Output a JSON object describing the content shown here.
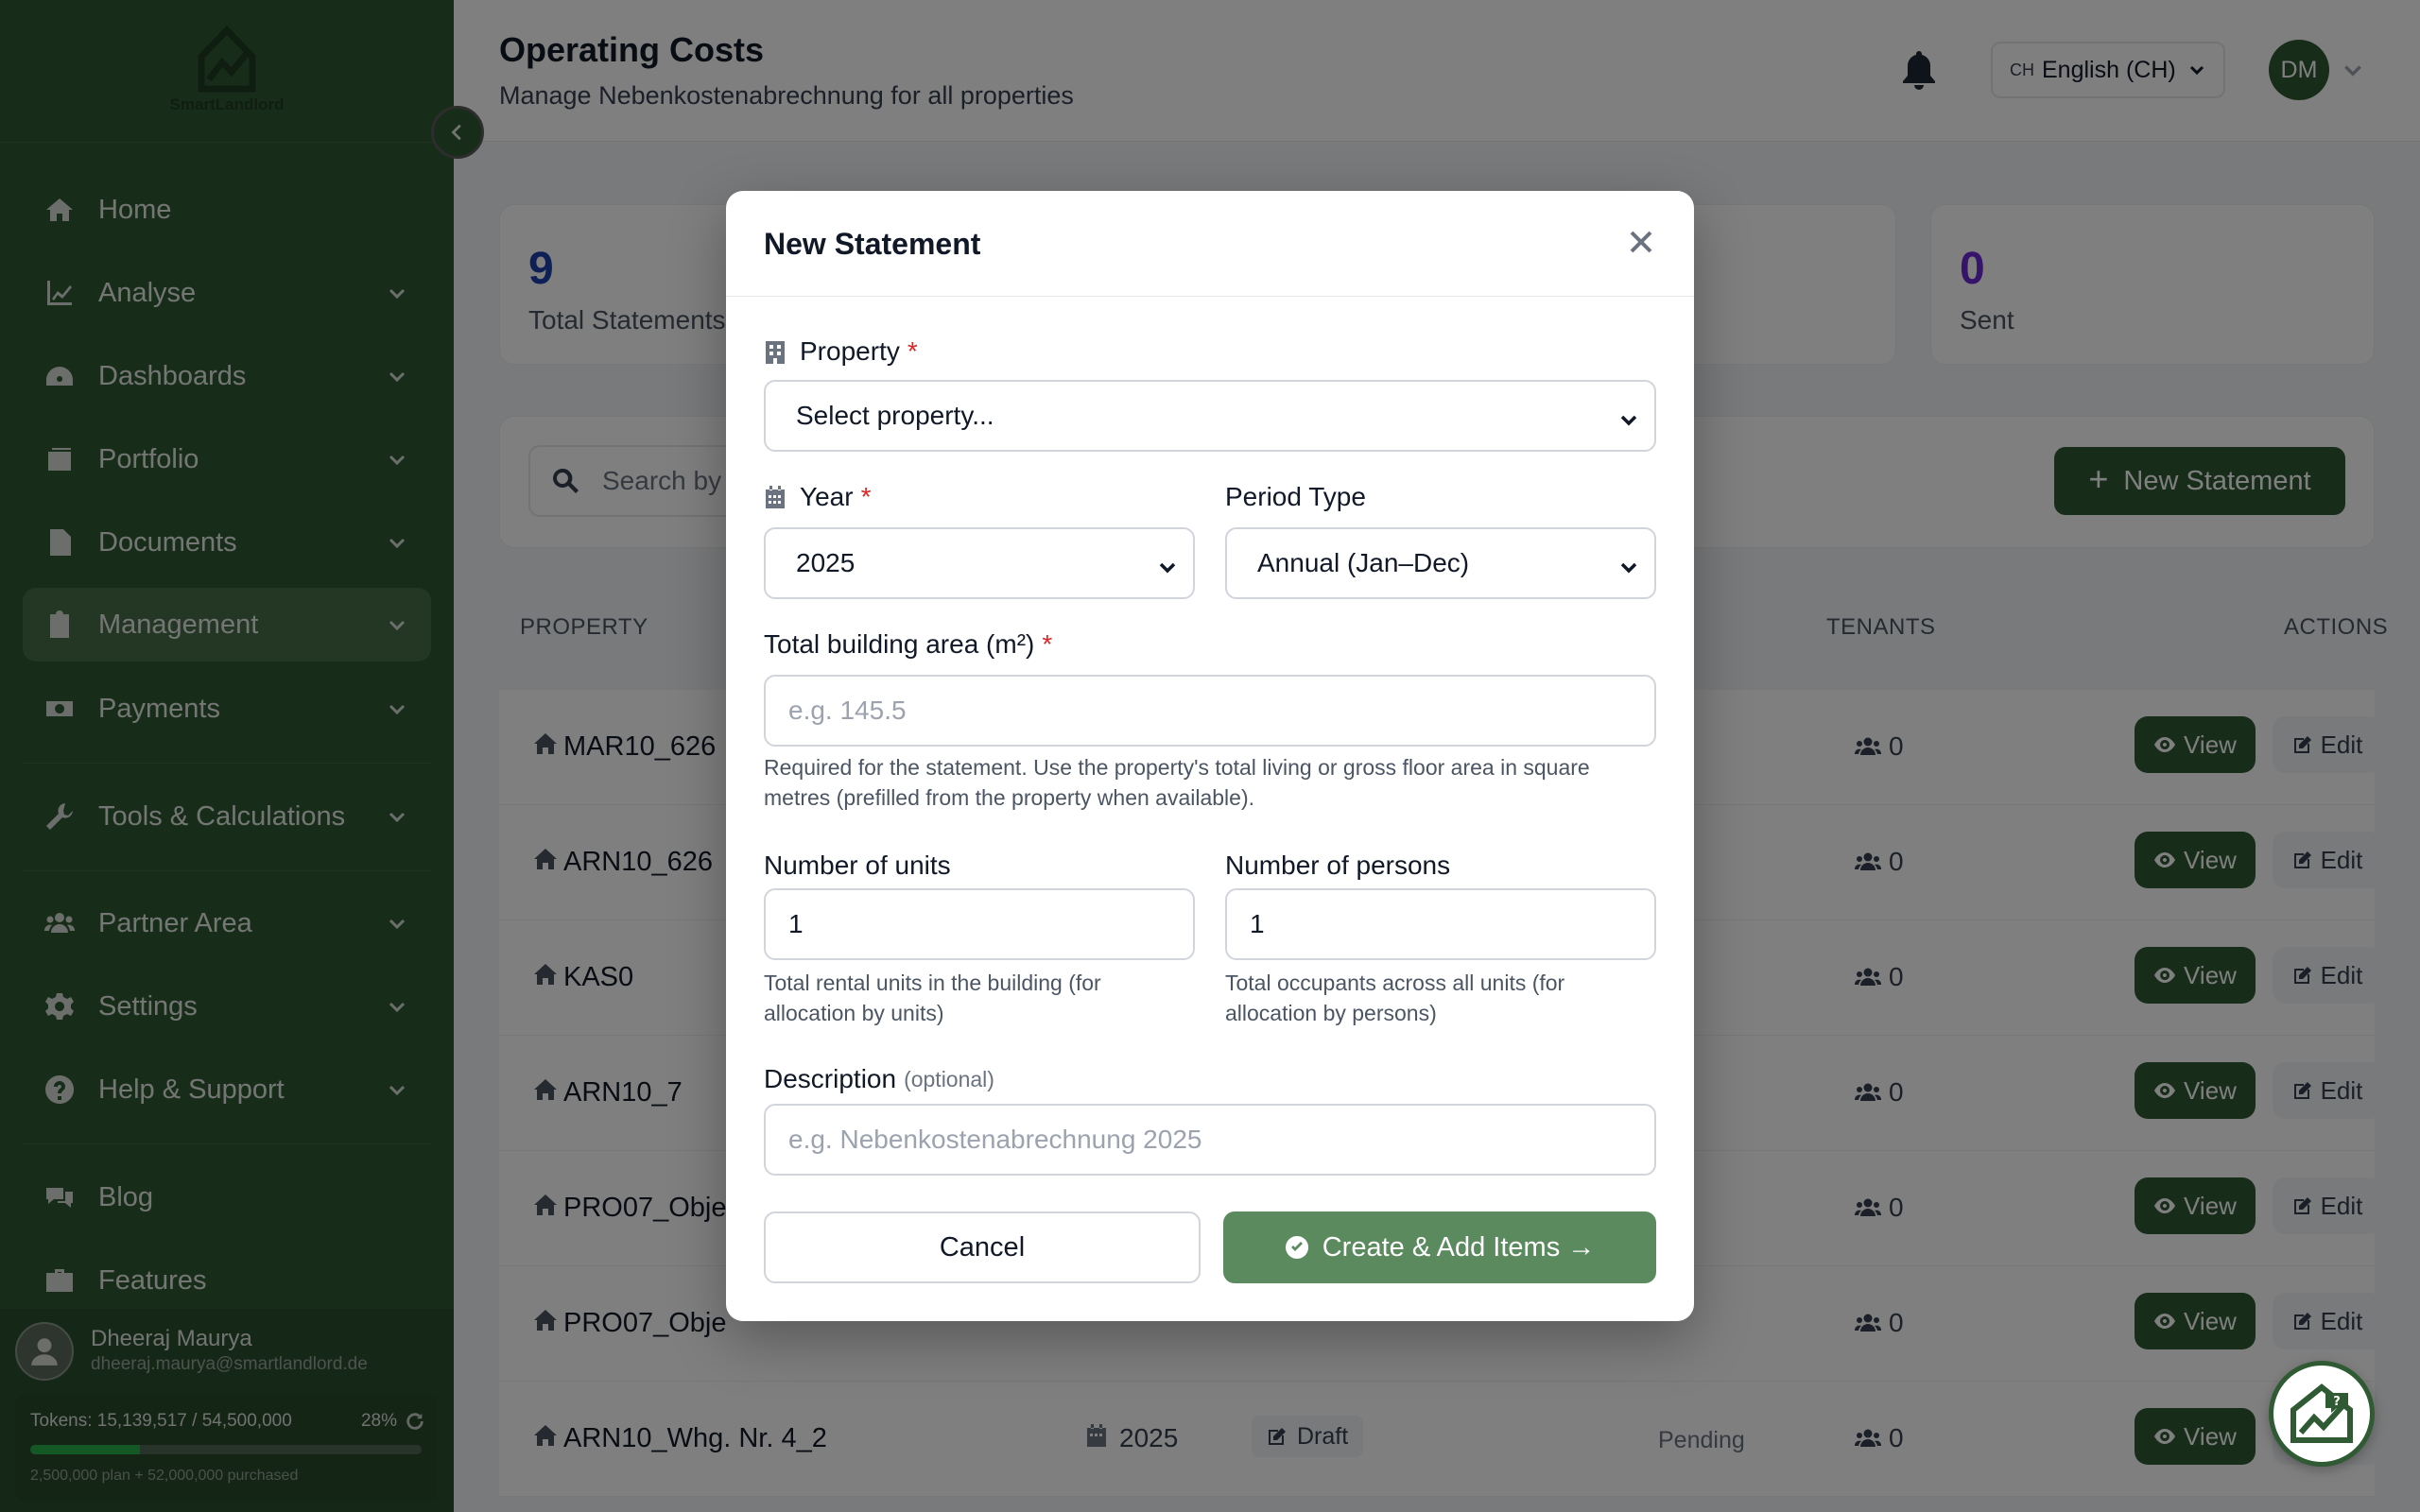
{
  "brand": {
    "name": "SmartLandlord"
  },
  "sidebar": {
    "items": [
      {
        "label": "Home",
        "icon": "home-icon"
      },
      {
        "label": "Analyse",
        "icon": "chart-line-icon"
      },
      {
        "label": "Dashboards",
        "icon": "gauge-icon"
      },
      {
        "label": "Portfolio",
        "icon": "portfolio-icon"
      },
      {
        "label": "Documents",
        "icon": "document-icon"
      },
      {
        "label": "Management",
        "icon": "clipboard-icon",
        "active": true
      },
      {
        "label": "Payments",
        "icon": "money-icon"
      },
      {
        "label": "Tools & Calculations",
        "icon": "wrench-icon"
      },
      {
        "label": "Partner Area",
        "icon": "users-icon"
      },
      {
        "label": "Settings",
        "icon": "gear-icon"
      },
      {
        "label": "Help & Support",
        "icon": "question-icon"
      },
      {
        "label": "Blog",
        "icon": "comments-icon"
      },
      {
        "label": "Features",
        "icon": "briefcase-icon"
      }
    ],
    "user": {
      "name": "Dheeraj Maurya",
      "email": "dheeraj.maurya@smartlandlord.de"
    },
    "tokens": {
      "text": "Tokens: 15,139,517 / 54,500,000",
      "percent_label": "28%",
      "percent": 28,
      "plan": "2,500,000 plan + 52,000,000 purchased"
    }
  },
  "header": {
    "title": "Operating Costs",
    "subtitle": "Manage Nebenkostenabrechnung for all properties",
    "language_code": "CH",
    "language": "English (CH)",
    "avatar_initials": "DM"
  },
  "stats": [
    {
      "value": "9",
      "label": "Total Statements",
      "color": "#1e40af"
    },
    {
      "value": "0",
      "label": "Sent",
      "color": "#6d28d9"
    }
  ],
  "toolbar": {
    "search_placeholder": "Search by p",
    "new_statement_label": "New Statement"
  },
  "table": {
    "headers": {
      "property": "PROPERTY",
      "tenants": "TENANTS",
      "actions": "ACTIONS"
    },
    "rows": [
      {
        "property": "MAR10_626",
        "tenants": "0"
      },
      {
        "property": "ARN10_626",
        "tenants": "0"
      },
      {
        "property": "KAS0",
        "tenants": "0"
      },
      {
        "property": "ARN10_7",
        "tenants": "0"
      },
      {
        "property": "PRO07_Obje",
        "tenants": "0"
      },
      {
        "property": "PRO07_Obje",
        "tenants": "0"
      },
      {
        "property": "ARN10_Whg. Nr. 4_2",
        "year": "2025",
        "status": "Draft",
        "payment": "Pending",
        "tenants": "0"
      }
    ],
    "view_label": "View",
    "edit_label": "Edit"
  },
  "modal": {
    "title": "New Statement",
    "property_label": "Property",
    "property_value": "Select property...",
    "year_label": "Year",
    "year_value": "2025",
    "period_label": "Period Type",
    "period_value": "Annual (Jan–Dec)",
    "area_label": "Total building area (m²)",
    "area_placeholder": "e.g. 145.5",
    "area_help": "Required for the statement. Use the property's total living or gross floor area in square metres (prefilled from the property when available).",
    "units_label": "Number of units",
    "units_value": "1",
    "units_help": "Total rental units in the building (for allocation by units)",
    "persons_label": "Number of persons",
    "persons_value": "1",
    "persons_help": "Total occupants across all units (for allocation by persons)",
    "description_label": "Description",
    "optional_label": "(optional)",
    "description_placeholder": "e.g. Nebenkostenabrechnung 2025",
    "required_mark": "*",
    "cancel_label": "Cancel",
    "create_label": "Create & Add Items →"
  },
  "colors": {
    "sidebar": "#2f5a33",
    "primary_button": "#2f5a33",
    "create_button": "#5c8a5f",
    "required": "#dc2626"
  }
}
